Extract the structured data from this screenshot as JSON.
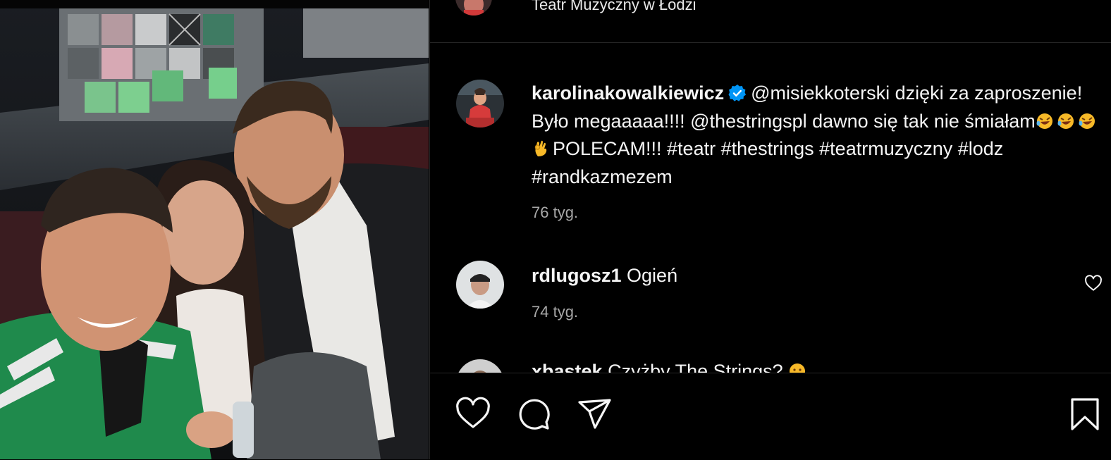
{
  "post": {
    "location": "Teatr Muzyczny w Łodzi",
    "author": "karolinakowalkiewicz",
    "verified": true,
    "caption_part1": "@misiekkoterski dzięki za zaproszenie! Było megaaaaa!!!! @thestringspl dawno się tak nie śmiałam",
    "caption_part2": "POLECAM!!! #teatr #thestrings #teatrmuzyczny #lodz #randkazmezem",
    "emojis": [
      "rolling-laughing",
      "rolling-laughing",
      "rolling-laughing",
      "ok-hand"
    ],
    "time": "76 tyg."
  },
  "comments": [
    {
      "user": "rdlugosz1",
      "text": "Ogień",
      "time": "74 tyg."
    },
    {
      "user": "xbastek",
      "text": "Czyżby The Strings?",
      "emoji": "smiling-face"
    }
  ],
  "actions": {
    "icons": [
      "heart-icon",
      "comment-icon",
      "share-icon",
      "bookmark-icon"
    ]
  },
  "colors": {
    "background": "#000000",
    "divider": "#262626",
    "text": "#f5f5f5",
    "secondary": "#a8a8a8",
    "verified": "#0095f6",
    "jacket_green": "#1f8a4c"
  }
}
